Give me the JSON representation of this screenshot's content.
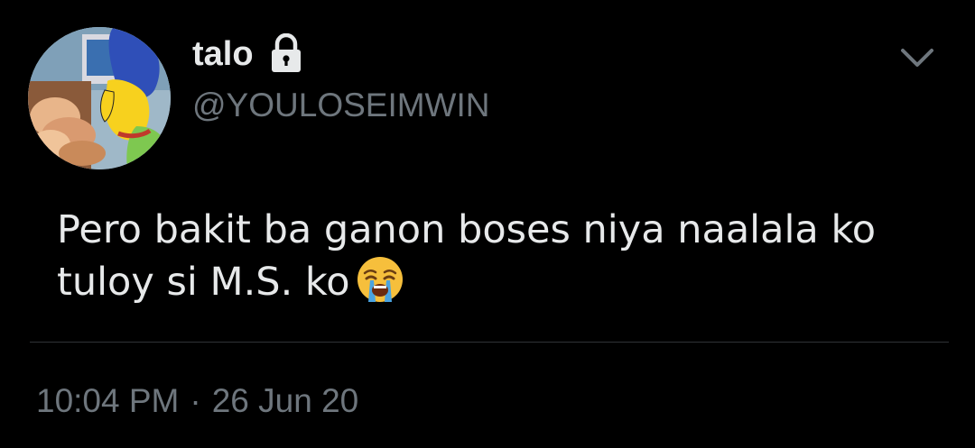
{
  "tweet": {
    "display_name": "talo",
    "handle": "@YOULOSEIMWIN",
    "text": "Pero bakit ba ganon boses niya naalala ko tuloy si M.S. ko",
    "emoji": "loudly-crying-face",
    "time": "10:04 PM",
    "separator": "·",
    "date": "26 Jun 20",
    "protected": true
  },
  "colors": {
    "background": "#000000",
    "primary_text": "#e7e9ea",
    "secondary_text": "#6e767d",
    "divider": "#2f3336"
  },
  "icons": {
    "lock": "lock-icon",
    "more": "chevron-down-icon",
    "avatar": "avatar"
  }
}
